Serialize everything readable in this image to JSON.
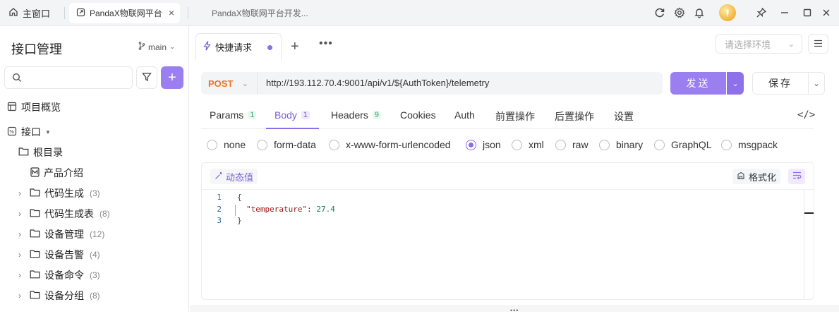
{
  "titlebar": {
    "home_tab": "主窗口",
    "active_tab": "PandaX物联网平台",
    "inactive_tab": "PandaX物联网平台开发..."
  },
  "sidebar": {
    "title": "接口管理",
    "branch": "main",
    "search_placeholder": "",
    "items": [
      {
        "label": "项目概览",
        "count": ""
      },
      {
        "label": "接口",
        "count": ""
      },
      {
        "label": "根目录",
        "count": ""
      },
      {
        "label": "产品介绍",
        "count": ""
      },
      {
        "label": "代码生成",
        "count": "(3)"
      },
      {
        "label": "代码生成表",
        "count": "(8)"
      },
      {
        "label": "设备管理",
        "count": "(12)"
      },
      {
        "label": "设备告警",
        "count": "(4)"
      },
      {
        "label": "设备命令",
        "count": "(3)"
      },
      {
        "label": "设备分组",
        "count": "(8)"
      }
    ]
  },
  "request": {
    "tab_label": "快捷请求",
    "env_placeholder": "请选择环境",
    "method": "POST",
    "url": "http://193.112.70.4:9001/api/v1/${AuthToken}/telemetry",
    "send_label": "发送",
    "save_label": "保存"
  },
  "subtabs": [
    {
      "label": "Params",
      "badge": "1"
    },
    {
      "label": "Body",
      "badge": "1"
    },
    {
      "label": "Headers",
      "badge": "9"
    },
    {
      "label": "Cookies",
      "badge": ""
    },
    {
      "label": "Auth",
      "badge": ""
    },
    {
      "label": "前置操作",
      "badge": ""
    },
    {
      "label": "后置操作",
      "badge": ""
    },
    {
      "label": "设置",
      "badge": ""
    }
  ],
  "body_types": [
    "none",
    "form-data",
    "x-www-form-urlencoded",
    "json",
    "xml",
    "raw",
    "binary",
    "GraphQL",
    "msgpack"
  ],
  "selected_body_type": "json",
  "editor": {
    "dynamic_label": "动态值",
    "format_label": "格式化",
    "lines": [
      {
        "n": "1",
        "open": "{"
      },
      {
        "n": "2",
        "key": "\"temperature\"",
        "sep": ": ",
        "value": "27.4"
      },
      {
        "n": "3",
        "close": "}"
      }
    ]
  },
  "colors": {
    "accent": "#9b7ff0",
    "method": "#e8762d"
  }
}
